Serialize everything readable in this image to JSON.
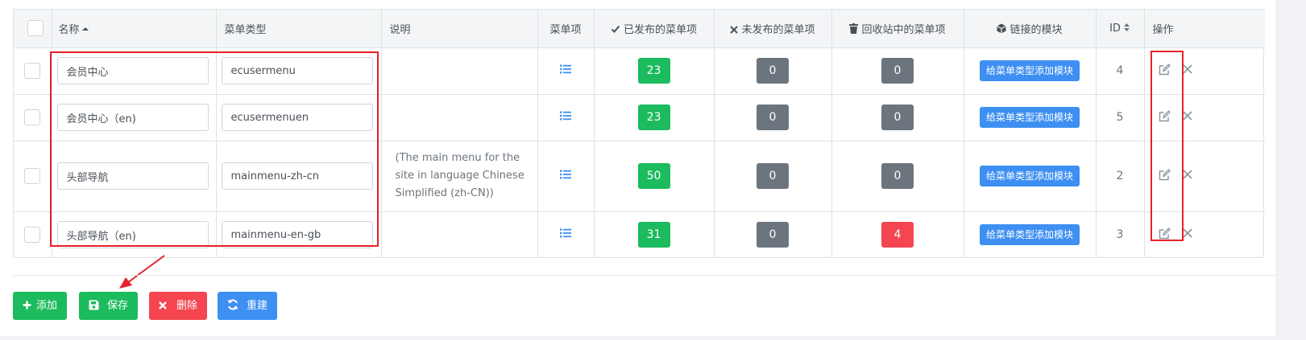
{
  "table": {
    "headers": {
      "name": "名称",
      "menu_type": "菜单类型",
      "description": "说明",
      "menu_items": "菜单项",
      "published": "已发布的菜单项",
      "unpublished": "未发布的菜单项",
      "trashed": "回收站中的菜单项",
      "linked_modules": "链接的模块",
      "id": "ID",
      "actions": "操作"
    },
    "rows": [
      {
        "name": "会员中心",
        "menu_type": "ecusermenu",
        "description": "",
        "published": "23",
        "unpublished": "0",
        "trashed": "0",
        "module_button": "给菜单类型添加模块",
        "id": "4"
      },
      {
        "name": "会员中心（en)",
        "menu_type": "ecusermenuen",
        "description": "",
        "published": "23",
        "unpublished": "0",
        "trashed": "0",
        "module_button": "给菜单类型添加模块",
        "id": "5"
      },
      {
        "name": "头部导航",
        "menu_type": "mainmenu-zh-cn",
        "description": "(The main menu for the site in language Chinese Simplified (zh-CN))",
        "published": "50",
        "unpublished": "0",
        "trashed": "0",
        "module_button": "给菜单类型添加模块",
        "id": "2"
      },
      {
        "name": "头部导航（en)",
        "menu_type": "mainmenu-en-gb",
        "description": "",
        "published": "31",
        "unpublished": "0",
        "trashed": "4",
        "module_button": "给菜单类型添加模块",
        "id": "3"
      }
    ]
  },
  "toolbar": {
    "add_label": "添加",
    "save_label": "保存",
    "delete_label": "删除",
    "rebuild_label": "重建"
  },
  "colors": {
    "success": "#1cbb5e",
    "secondary": "#6c757d",
    "danger": "#f44550",
    "primary": "#3d8ff2",
    "annotation": "#e8202a"
  }
}
